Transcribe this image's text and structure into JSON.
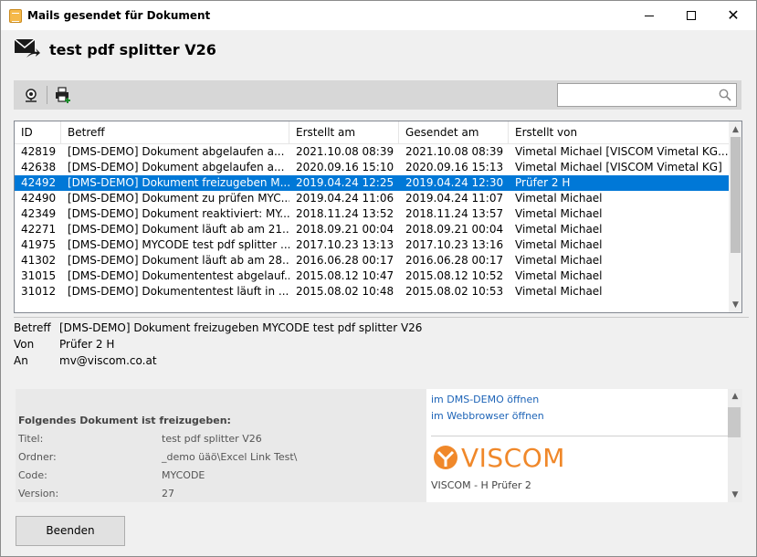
{
  "window": {
    "title": "Mails gesendet für Dokument",
    "icon": "document-icon"
  },
  "header": {
    "title": "test pdf splitter V26",
    "icon": "mail-sent-icon"
  },
  "toolbar": {
    "button1_icon": "network-globe-icon",
    "button2_icon": "printer-add-icon",
    "search_value": "",
    "search_icon": "search-icon"
  },
  "table": {
    "columns": [
      "ID",
      "Betreff",
      "Erstellt am",
      "Gesendet am",
      "Erstellt von"
    ],
    "selected_index": 2,
    "rows": [
      [
        "42819",
        "[DMS-DEMO] Dokument abgelaufen a...",
        "2021.10.08 08:39",
        "2021.10.08 08:39",
        "Vimetal Michael [VISCOM Vimetal KG...."
      ],
      [
        "42638",
        "[DMS-DEMO] Dokument abgelaufen a...",
        "2020.09.16 15:10",
        "2020.09.16 15:13",
        "Vimetal Michael [VISCOM Vimetal KG]"
      ],
      [
        "42492",
        "[DMS-DEMO] Dokument freizugeben M...",
        "2019.04.24 12:25",
        "2019.04.24 12:30",
        "Prüfer 2 H"
      ],
      [
        "42490",
        "[DMS-DEMO] Dokument zu prüfen MYC...",
        "2019.04.24 11:06",
        "2019.04.24 11:07",
        "Vimetal Michael"
      ],
      [
        "42349",
        "[DMS-DEMO] Dokument reaktiviert: MY...",
        "2018.11.24 13:52",
        "2018.11.24 13:57",
        "Vimetal Michael"
      ],
      [
        "42271",
        "[DMS-DEMO] Dokument läuft ab am 21...",
        "2018.09.21 00:04",
        "2018.09.21 00:04",
        "Vimetal Michael"
      ],
      [
        "41975",
        "[DMS-DEMO] MYCODE test pdf splitter ...",
        "2017.10.23 13:13",
        "2017.10.23 13:16",
        "Vimetal Michael"
      ],
      [
        "41302",
        "[DMS-DEMO] Dokument läuft ab am 28...",
        "2016.06.28 00:17",
        "2016.06.28 00:17",
        "Vimetal Michael"
      ],
      [
        "31015",
        "[DMS-DEMO] Dokumententest abgelauf...",
        "2015.08.12 10:47",
        "2015.08.12 10:52",
        "Vimetal Michael"
      ],
      [
        "31012",
        "[DMS-DEMO] Dokumententest läuft in ...",
        "2015.08.02 10:48",
        "2015.08.02 10:53",
        "Vimetal Michael"
      ]
    ]
  },
  "details": {
    "betreff_label": "Betreff",
    "betreff_value": "[DMS-DEMO] Dokument freizugeben MYCODE test pdf splitter V26",
    "von_label": "Von",
    "von_value": "Prüfer 2 H",
    "an_label": "An",
    "an_value": "mv@viscom.co.at"
  },
  "preview": {
    "heading": "Folgendes Dokument ist freizugeben:",
    "fields": [
      {
        "label": "Titel:",
        "value": "test pdf splitter V26"
      },
      {
        "label": "Ordner:",
        "value": "_demo üäö\\Excel Link Test\\"
      },
      {
        "label": "Code:",
        "value": "MYCODE"
      },
      {
        "label": "Version:",
        "value": "27"
      }
    ],
    "link_dms": "im DMS-DEMO öffnen",
    "link_browser": "im Webbrowser öffnen",
    "logo_text": "VISCOM",
    "signature": "VISCOM - H Prüfer 2"
  },
  "footer": {
    "close_label": "Beenden"
  },
  "colors": {
    "selection": "#0078d7",
    "link": "#1c63b7",
    "logo": "#f0882a"
  }
}
